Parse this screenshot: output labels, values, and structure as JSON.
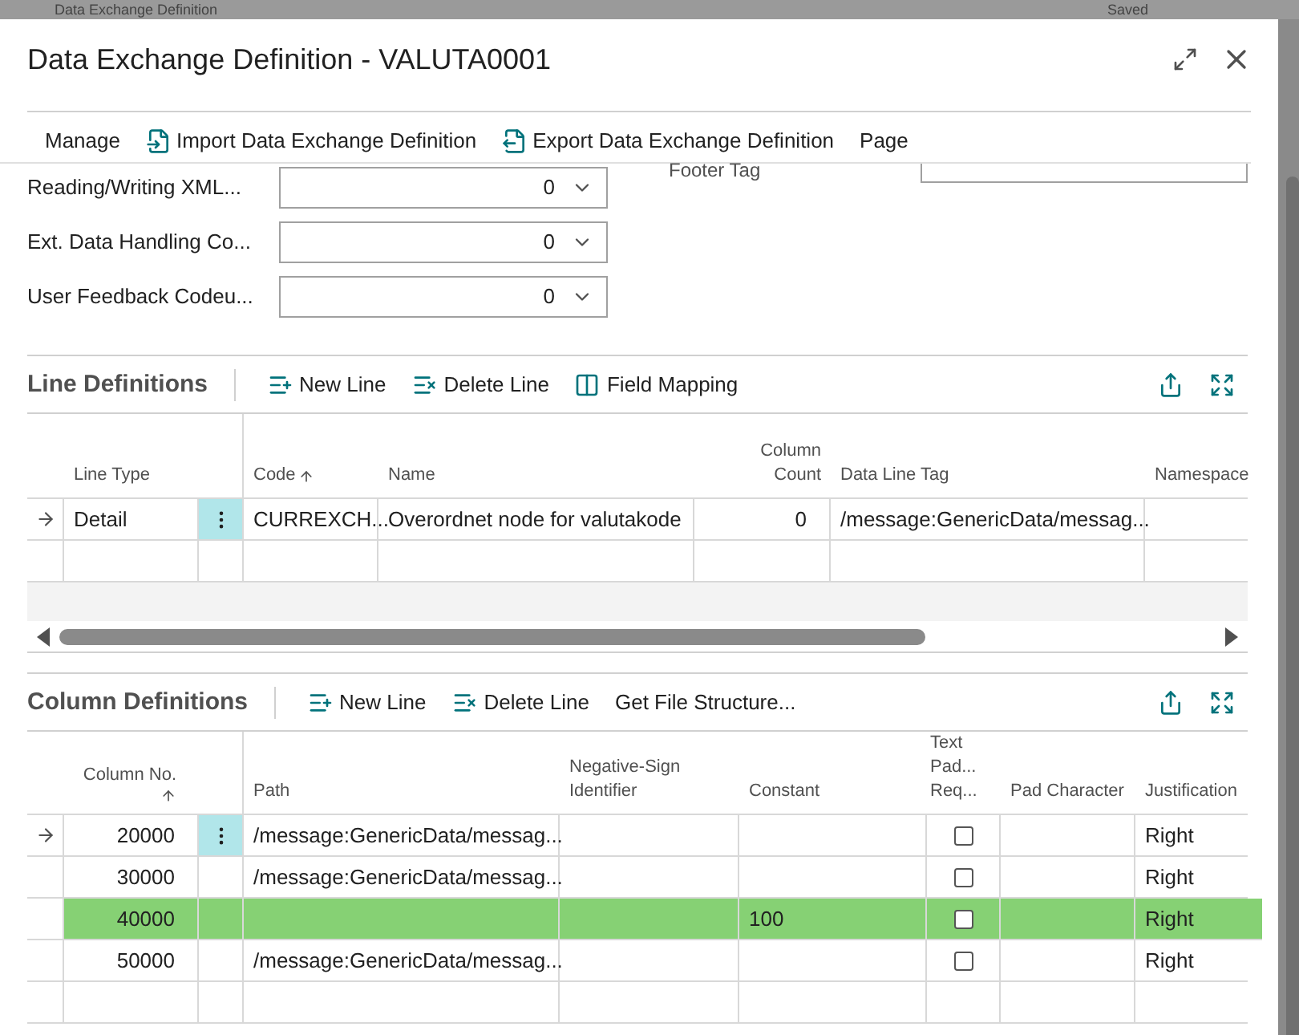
{
  "background_page": {
    "title": "Data Exchange Definition",
    "status": "Saved"
  },
  "dialog": {
    "title": "Data Exchange Definition - VALUTA0001"
  },
  "actions": [
    {
      "label": "Manage",
      "kind": "text"
    },
    {
      "label": "Import Data Exchange Definition",
      "kind": "import"
    },
    {
      "label": "Export Data Exchange Definition",
      "kind": "export"
    },
    {
      "label": "Page",
      "kind": "text"
    }
  ],
  "fields": [
    {
      "label": "Reading/Writing XML...",
      "value": "0"
    },
    {
      "label": "Ext. Data Handling Co...",
      "value": "0"
    },
    {
      "label": "User Feedback Codeu...",
      "value": "0"
    }
  ],
  "footer_tag": {
    "label": "Footer Tag"
  },
  "line_definitions": {
    "title": "Line Definitions",
    "actions": [
      {
        "label": "New Line",
        "kind": "new"
      },
      {
        "label": "Delete Line",
        "kind": "delete"
      },
      {
        "label": "Field Mapping",
        "kind": "mapping"
      }
    ],
    "columns": [
      {
        "label": "Line Type",
        "kind": "text",
        "sorted": false
      },
      {
        "label": "Code",
        "kind": "text",
        "sorted": true
      },
      {
        "label": "Name",
        "kind": "text",
        "sorted": false
      },
      {
        "label": "Column Count",
        "kind": "number",
        "sorted": false
      },
      {
        "label": "Data Line Tag",
        "kind": "text",
        "sorted": false
      },
      {
        "label": "Namespace",
        "kind": "text",
        "sorted": false
      }
    ],
    "rows": [
      {
        "current": true,
        "highlighted": false,
        "cells": [
          "Detail",
          "CURREXCH...",
          "Overordnet node for valutakode",
          "0",
          "/message:GenericData/messag...",
          null
        ]
      }
    ]
  },
  "column_definitions": {
    "title": "Column Definitions",
    "actions": [
      {
        "label": "New Line",
        "kind": "new"
      },
      {
        "label": "Delete Line",
        "kind": "delete"
      },
      {
        "label": "Get File Structure...",
        "kind": "text"
      }
    ],
    "columns": [
      {
        "label": "Column No.",
        "kind": "number",
        "sorted": true
      },
      {
        "label": "Path",
        "kind": "text",
        "sorted": false
      },
      {
        "label": "Negative-Sign Identifier",
        "kind": "text",
        "sorted": false
      },
      {
        "label": "Constant",
        "kind": "text",
        "sorted": false
      },
      {
        "label": "Text Pad... Req...",
        "kind": "checkbox",
        "sorted": false
      },
      {
        "label": "Pad Character",
        "kind": "text",
        "sorted": false
      },
      {
        "label": "Justification",
        "kind": "text",
        "sorted": false
      }
    ],
    "rows": [
      {
        "current": true,
        "highlighted": false,
        "cells": [
          "20000",
          "/message:GenericData/messag...",
          null,
          null,
          {
            "checked": false
          },
          null,
          "Right"
        ]
      },
      {
        "current": false,
        "highlighted": false,
        "cells": [
          "30000",
          "/message:GenericData/messag...",
          null,
          null,
          {
            "checked": false
          },
          null,
          "Right"
        ]
      },
      {
        "current": false,
        "highlighted": true,
        "cells": [
          "40000",
          null,
          null,
          "100",
          {
            "checked": false
          },
          null,
          "Right"
        ]
      },
      {
        "current": false,
        "highlighted": false,
        "cells": [
          "50000",
          "/message:GenericData/messag...",
          null,
          null,
          {
            "checked": false
          },
          null,
          "Right"
        ]
      }
    ]
  }
}
